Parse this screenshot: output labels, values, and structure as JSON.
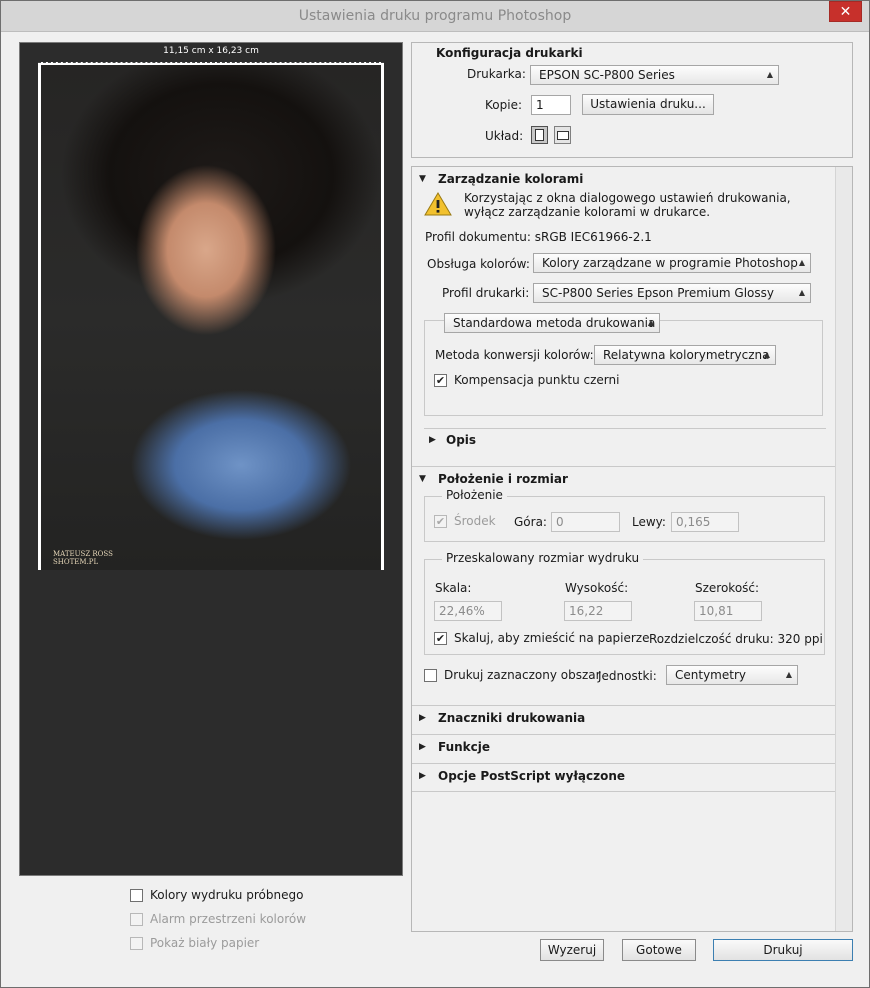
{
  "window": {
    "title": "Ustawienia druku programu Photoshop",
    "close_glyph": "✕"
  },
  "preview": {
    "paper_size": "11,15 cm x 16,23 cm",
    "watermark_line1": "MATEUSZ ROSS",
    "watermark_line2": "SHOTEM.PL"
  },
  "proof": {
    "items": [
      {
        "label": "Kolory wydruku próbnego",
        "checked": false,
        "enabled": true
      },
      {
        "label": "Alarm przestrzeni kolorów",
        "checked": false,
        "enabled": false
      },
      {
        "label": "Pokaż biały papier",
        "checked": false,
        "enabled": false
      }
    ]
  },
  "printer_setup": {
    "heading": "Konfiguracja drukarki",
    "printer_label": "Drukarka:",
    "printer_value": "EPSON SC-P800 Series",
    "copies_label": "Kopie:",
    "copies_value": "1",
    "print_settings_button": "Ustawienia druku...",
    "layout_label": "Układ:"
  },
  "color_management": {
    "heading": "Zarządzanie kolorami",
    "warning_line1": "Korzystając z okna dialogowego ustawień drukowania,",
    "warning_line2": "wyłącz zarządzanie kolorami w drukarce.",
    "doc_profile_label": "Profil dokumentu:",
    "doc_profile_value": "sRGB IEC61966-2.1",
    "color_handling_label": "Obsługa kolorów:",
    "color_handling_value": "Kolory zarządzane w programie Photoshop",
    "printer_profile_label": "Profil drukarki:",
    "printer_profile_value": "SC-P800 Series Epson Premium Glossy",
    "print_method_value": "Standardowa metoda drukowania",
    "rendering_intent_label": "Metoda konwersji kolorów:",
    "rendering_intent_value": "Relatywna kolorymetryczna",
    "black_point_label": "Kompensacja punktu czerni",
    "black_point_checked": true
  },
  "description": {
    "heading": "Opis"
  },
  "position_size": {
    "heading": "Położenie i rozmiar",
    "position_group": "Położenie",
    "center_label": "Środek",
    "center_checked": true,
    "top_label": "Góra:",
    "top_value": "0",
    "left_label": "Lewy:",
    "left_value": "0,165",
    "scaled_group": "Przeskalowany rozmiar wydruku",
    "scale_label": "Skala:",
    "scale_value": "22,46%",
    "height_label": "Wysokość:",
    "height_value": "16,22",
    "width_label": "Szerokość:",
    "width_value": "10,81",
    "fit_label": "Skaluj, aby zmieścić na papierze",
    "fit_checked": true,
    "resolution_text": "Rozdzielczość druku: 320 ppi",
    "print_selection_label": "Drukuj zaznaczony obszar",
    "print_selection_checked": false,
    "units_label": "Jednostki:",
    "units_value": "Centymetry"
  },
  "collapsed_sections": {
    "marks": "Znaczniki drukowania",
    "functions": "Funkcje",
    "postscript": "Opcje PostScript wyłączone"
  },
  "footer": {
    "reset": "Wyzeruj",
    "done": "Gotowe",
    "print": "Drukuj"
  },
  "colors": {
    "close": "#c7302b",
    "preview_bg": "#2c2c2c",
    "warning": "#f2c12e"
  }
}
